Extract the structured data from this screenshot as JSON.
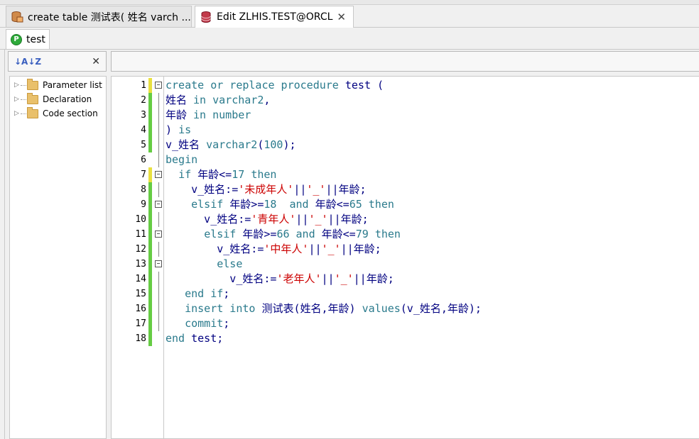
{
  "tabs": [
    {
      "label": "create table 测试表( 姓名 varch ...",
      "icon": "database-table-icon",
      "active": false
    },
    {
      "label": "Edit ZLHIS.TEST@ORCL",
      "icon": "database-edit-icon",
      "active": true,
      "close": "✕"
    }
  ],
  "subtab": {
    "badge": "P",
    "label": "test"
  },
  "left_panel": {
    "sort_icon": "↓A↓Z",
    "close": "✕",
    "tree": [
      "Parameter list",
      "Declaration",
      "Code section"
    ]
  },
  "editor": {
    "lines": [
      {
        "n": "1",
        "change": "yellow",
        "fold": "minus",
        "tokens": [
          {
            "t": "create or replace procedure",
            "c": "kw"
          },
          {
            "t": " test (",
            "c": "pl"
          }
        ]
      },
      {
        "n": "2",
        "change": "green",
        "tokens": [
          {
            "t": "姓名 ",
            "c": "pl"
          },
          {
            "t": "in varchar2",
            "c": "kw"
          },
          {
            "t": ",",
            "c": "pl"
          }
        ]
      },
      {
        "n": "3",
        "change": "green",
        "tokens": [
          {
            "t": "年龄 ",
            "c": "pl"
          },
          {
            "t": "in number",
            "c": "kw"
          }
        ]
      },
      {
        "n": "4",
        "change": "green",
        "tokens": [
          {
            "t": ") ",
            "c": "pl"
          },
          {
            "t": "is",
            "c": "kw"
          }
        ]
      },
      {
        "n": "5",
        "change": "green",
        "tokens": [
          {
            "t": "v_姓名 ",
            "c": "pl"
          },
          {
            "t": "varchar2",
            "c": "kw"
          },
          {
            "t": "(",
            "c": "pl"
          },
          {
            "t": "100",
            "c": "kw"
          },
          {
            "t": ");",
            "c": "pl"
          }
        ]
      },
      {
        "n": "6",
        "change": "none",
        "tokens": [
          {
            "t": "begin",
            "c": "kw"
          }
        ]
      },
      {
        "n": "7",
        "change": "yellow",
        "fold": "minus",
        "tokens": [
          {
            "t": "  ",
            "c": "pl"
          },
          {
            "t": "if",
            "c": "kw"
          },
          {
            "t": " 年龄<=",
            "c": "pl"
          },
          {
            "t": "17",
            "c": "kw"
          },
          {
            "t": " ",
            "c": "pl"
          },
          {
            "t": "then",
            "c": "kw"
          }
        ]
      },
      {
        "n": "8",
        "change": "green",
        "tokens": [
          {
            "t": "    v_姓名:=",
            "c": "pl"
          },
          {
            "t": "'未成年人'",
            "c": "str"
          },
          {
            "t": "||",
            "c": "pl"
          },
          {
            "t": "'_'",
            "c": "str"
          },
          {
            "t": "||年龄;",
            "c": "pl"
          }
        ]
      },
      {
        "n": "9",
        "change": "green",
        "fold": "minus",
        "tokens": [
          {
            "t": "    ",
            "c": "pl"
          },
          {
            "t": "elsif",
            "c": "kw"
          },
          {
            "t": " 年龄>=",
            "c": "pl"
          },
          {
            "t": "18",
            "c": "kw"
          },
          {
            "t": "  ",
            "c": "pl"
          },
          {
            "t": "and",
            "c": "kw"
          },
          {
            "t": " 年龄<=",
            "c": "pl"
          },
          {
            "t": "65",
            "c": "kw"
          },
          {
            "t": " ",
            "c": "pl"
          },
          {
            "t": "then",
            "c": "kw"
          }
        ]
      },
      {
        "n": "10",
        "change": "green",
        "tokens": [
          {
            "t": "      v_姓名:=",
            "c": "pl"
          },
          {
            "t": "'青年人'",
            "c": "str"
          },
          {
            "t": "||",
            "c": "pl"
          },
          {
            "t": "'_'",
            "c": "str"
          },
          {
            "t": "||年龄;",
            "c": "pl"
          }
        ]
      },
      {
        "n": "11",
        "change": "green",
        "fold": "minus",
        "tokens": [
          {
            "t": "      ",
            "c": "pl"
          },
          {
            "t": "elsif",
            "c": "kw"
          },
          {
            "t": " 年龄>=",
            "c": "pl"
          },
          {
            "t": "66",
            "c": "kw"
          },
          {
            "t": " ",
            "c": "pl"
          },
          {
            "t": "and",
            "c": "kw"
          },
          {
            "t": " 年龄<=",
            "c": "pl"
          },
          {
            "t": "79",
            "c": "kw"
          },
          {
            "t": " ",
            "c": "pl"
          },
          {
            "t": "then",
            "c": "kw"
          }
        ]
      },
      {
        "n": "12",
        "change": "green",
        "tokens": [
          {
            "t": "        v_姓名:=",
            "c": "pl"
          },
          {
            "t": "'中年人'",
            "c": "str"
          },
          {
            "t": "||",
            "c": "pl"
          },
          {
            "t": "'_'",
            "c": "str"
          },
          {
            "t": "||年龄;",
            "c": "pl"
          }
        ]
      },
      {
        "n": "13",
        "change": "green",
        "fold": "minus",
        "tokens": [
          {
            "t": "        ",
            "c": "pl"
          },
          {
            "t": "else",
            "c": "kw"
          }
        ]
      },
      {
        "n": "14",
        "change": "green",
        "tokens": [
          {
            "t": "          v_姓名:=",
            "c": "pl"
          },
          {
            "t": "'老年人'",
            "c": "str"
          },
          {
            "t": "||",
            "c": "pl"
          },
          {
            "t": "'_'",
            "c": "str"
          },
          {
            "t": "||年龄;",
            "c": "pl"
          }
        ]
      },
      {
        "n": "15",
        "change": "green",
        "tokens": [
          {
            "t": "   ",
            "c": "pl"
          },
          {
            "t": "end if",
            "c": "kw"
          },
          {
            "t": ";",
            "c": "pl"
          }
        ]
      },
      {
        "n": "16",
        "change": "green",
        "tokens": [
          {
            "t": "   ",
            "c": "pl"
          },
          {
            "t": "insert into",
            "c": "kw"
          },
          {
            "t": " 测试表(姓名,年龄) ",
            "c": "pl"
          },
          {
            "t": "values",
            "c": "kw"
          },
          {
            "t": "(v_姓名,年龄);",
            "c": "pl"
          }
        ]
      },
      {
        "n": "17",
        "change": "green",
        "tokens": [
          {
            "t": "   ",
            "c": "pl"
          },
          {
            "t": "commit",
            "c": "kw"
          },
          {
            "t": ";",
            "c": "pl"
          }
        ]
      },
      {
        "n": "18",
        "change": "green",
        "tokens": [
          {
            "t": "end",
            "c": "kw"
          },
          {
            "t": " test;",
            "c": "pl"
          }
        ]
      }
    ]
  },
  "colors": {
    "keyword": "#2a7a8c",
    "string": "#cc0000",
    "plain": "#000080",
    "change_green": "#66cc44",
    "change_yellow": "#e8e040"
  }
}
